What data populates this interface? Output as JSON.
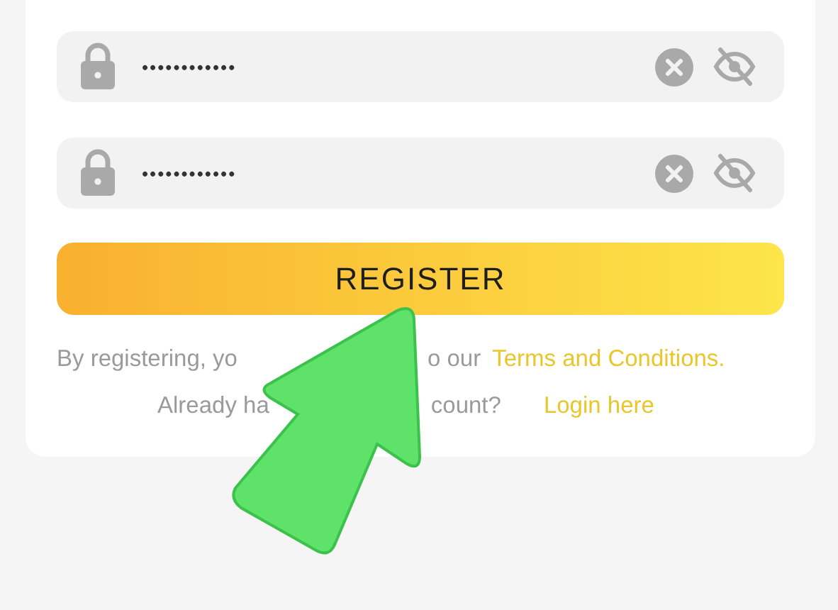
{
  "fields": [
    {
      "kind": "password",
      "value": "••••••••••••"
    },
    {
      "kind": "password",
      "value": "••••••••••••"
    }
  ],
  "register_button": {
    "label": "REGISTER"
  },
  "terms_line": {
    "before": "By registering, yo",
    "after": "o our",
    "link": "Terms and Conditions."
  },
  "login_line": {
    "before": "Already ha",
    "after": "count?",
    "link": "Login here"
  }
}
